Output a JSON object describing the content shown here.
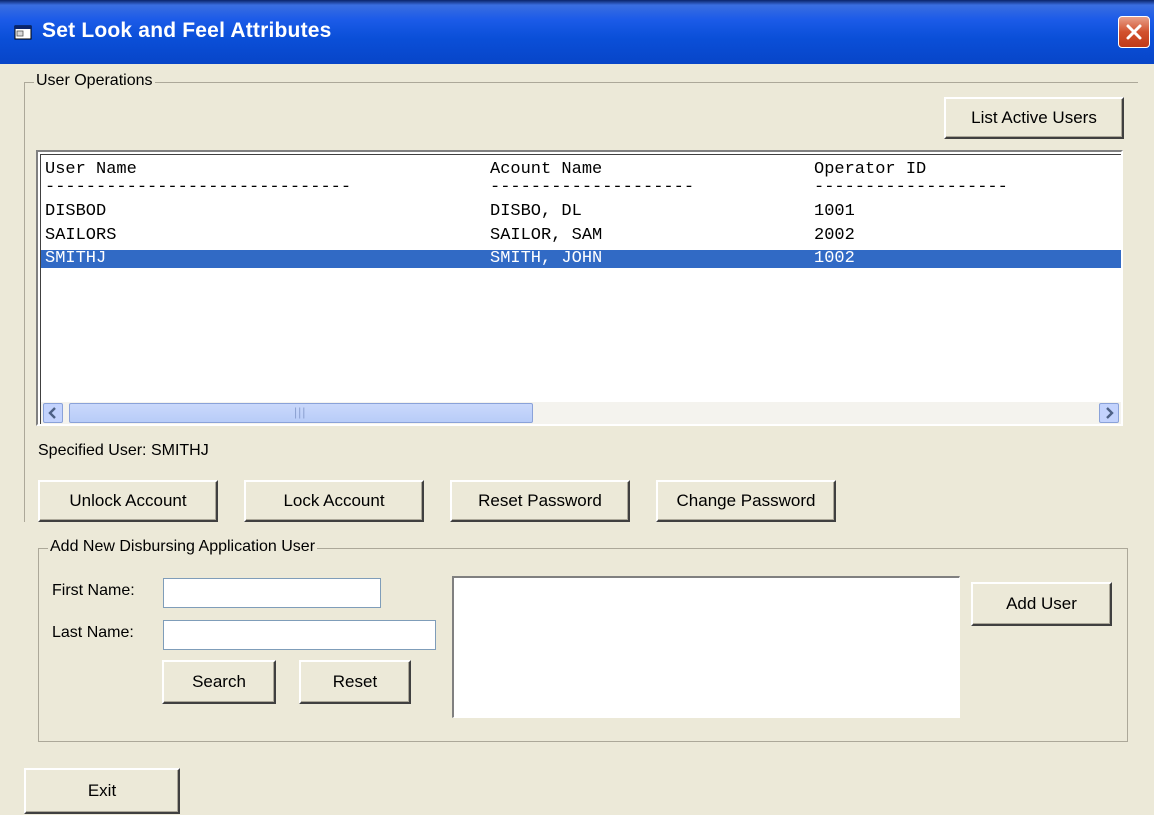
{
  "window": {
    "title": "Set Look and Feel Attributes",
    "app_icon": "window-icon",
    "close_icon": "close-icon"
  },
  "user_operations": {
    "group_label": "User Operations",
    "list_active_users_label": "List Active Users",
    "columns": [
      "User Name",
      "Acount Name",
      "Operator ID"
    ],
    "separators": [
      "------------------------------",
      "--------------------",
      "-------------------"
    ],
    "rows": [
      {
        "user_name": "DISBOD",
        "account_name": "DISBO, DL",
        "operator_id": "1001",
        "selected": false
      },
      {
        "user_name": "SAILORS",
        "account_name": "SAILOR, SAM",
        "operator_id": "2002",
        "selected": false
      },
      {
        "user_name": "SMITHJ",
        "account_name": "SMITH, JOHN",
        "operator_id": "1002",
        "selected": true
      }
    ],
    "scrollbar_grip": "|||",
    "specified_user_text": "Specified User: SMITHJ",
    "unlock_account_label": "Unlock Account",
    "lock_account_label": "Lock Account",
    "reset_password_label": "Reset Password",
    "change_password_label": "Change Password"
  },
  "add_user": {
    "group_label": "Add New Disbursing Application User",
    "first_name_label": "First Name:",
    "first_name_value": "",
    "last_name_label": "Last Name:",
    "last_name_value": "",
    "search_label": "Search",
    "reset_label": "Reset",
    "add_user_label": "Add User"
  },
  "footer": {
    "exit_label": "Exit"
  },
  "colors": {
    "title_bar": "#0845c8",
    "selection": "#316ac5",
    "dialog_bg": "#ece9d8",
    "close_button": "#d2522e"
  }
}
